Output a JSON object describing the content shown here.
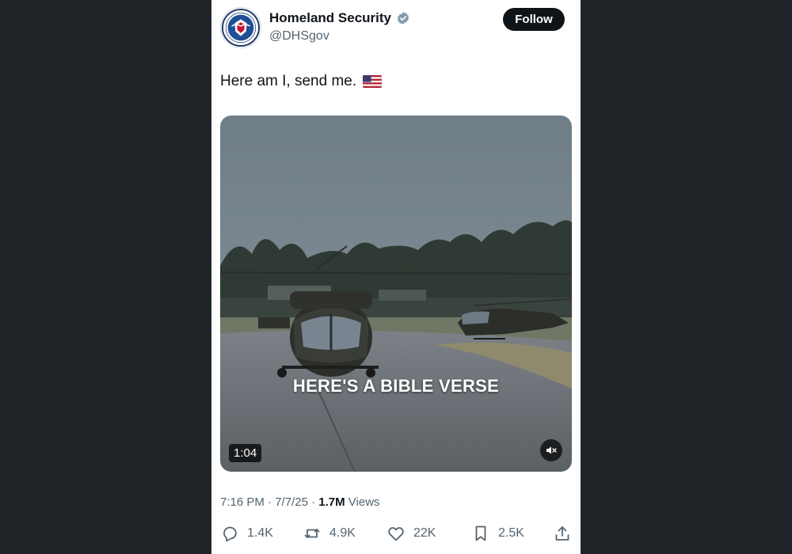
{
  "account": {
    "name": "Homeland Security",
    "handle": "@DHSgov",
    "verified": true,
    "avatar_icon": "dhs-seal-icon",
    "follow_label": "Follow"
  },
  "tweet": {
    "text": "Here am I, send me.",
    "emoji_icon": "us-flag-icon"
  },
  "video": {
    "caption": "HERE'S A BIBLE VERSE",
    "duration": "1:04",
    "mute_icon": "volume-muted-icon"
  },
  "meta": {
    "time": "7:16 PM",
    "sep1": " · ",
    "date": "7/7/25",
    "sep2": " · ",
    "views_count": "1.7M",
    "views_label": " Views"
  },
  "actions": {
    "replies": "1.4K",
    "reposts": "4.9K",
    "likes": "22K",
    "bookmarks": "2.5K"
  },
  "colors": {
    "background": "#202327",
    "card": "#ffffff",
    "text_primary": "#0f1419",
    "text_secondary": "#536471",
    "verified_badge": "#829aab"
  }
}
